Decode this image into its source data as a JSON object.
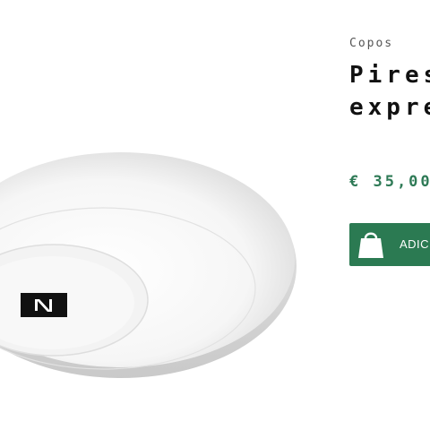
{
  "product": {
    "category": "Copos",
    "title": "Pires\nexpresso",
    "price": "€ 35,00",
    "image_logo_text": "N"
  },
  "cart_button": {
    "label": "ADICIONAR",
    "icon": "shopping-bag-icon"
  },
  "colors": {
    "price": "#2e7a56",
    "button_bg": "#2b7a52",
    "title": "#111111",
    "category": "#555555"
  }
}
